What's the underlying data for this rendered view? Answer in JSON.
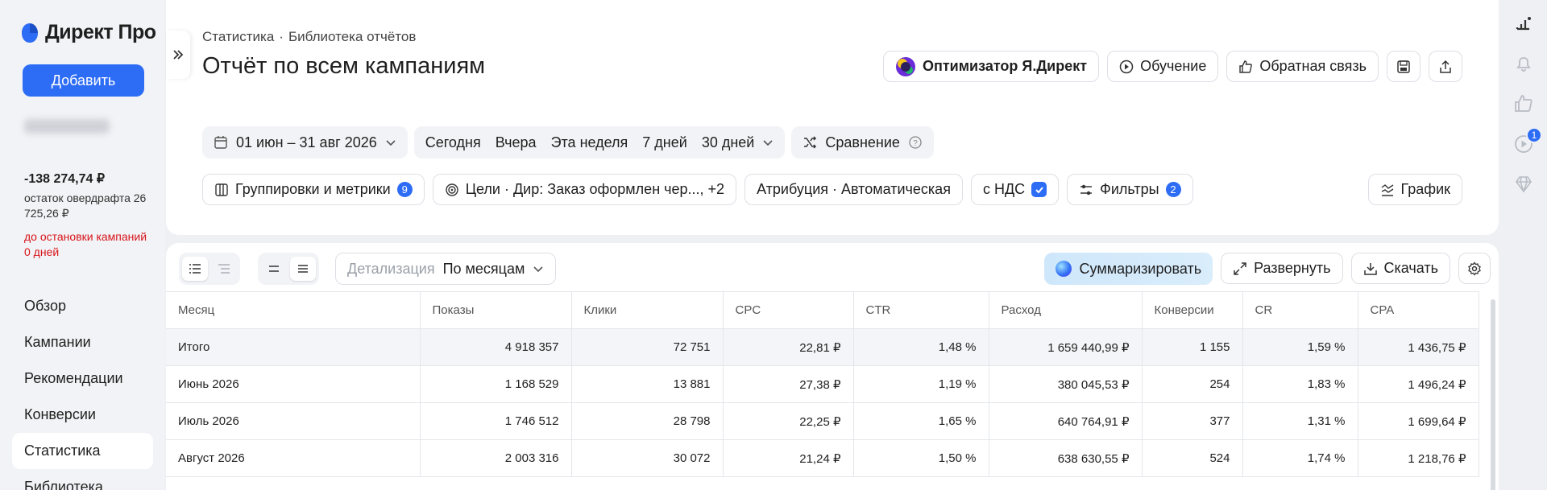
{
  "sidebar": {
    "logo_text": "Директ Про",
    "add_label": "Добавить",
    "balance": "-138 274,74 ₽",
    "overdraft_text": "остаток овердрафта 26 725,26 ₽",
    "warning_text": "до остановки кампаний 0 дней",
    "nav": [
      "Обзор",
      "Кампании",
      "Рекомендации",
      "Конверсии",
      "Статистика",
      "Библиотека"
    ],
    "active_item": "Статистика"
  },
  "header": {
    "breadcrumb": [
      "Статистика",
      "Библиотека отчётов"
    ],
    "breadcrumb_sep": "·",
    "title": "Отчёт по всем кампаниям",
    "optimizer_label": "Оптимизатор Я.Директ",
    "learning_label": "Обучение",
    "feedback_label": "Обратная связь"
  },
  "filters": {
    "date_range": "01 июн – 31 авг 2026",
    "periods": [
      "Сегодня",
      "Вчера",
      "Эта неделя",
      "7 дней",
      "30 дней"
    ],
    "compare_label": "Сравнение",
    "groupings_label": "Группировки и метрики",
    "groupings_count": "9",
    "goals_label": "Цели · Дир: Заказ оформлен чер..., +2",
    "attribution_label": "Атрибуция · Автоматическая",
    "vat_label": "с НДС",
    "filters_label": "Фильтры",
    "filters_count": "2",
    "chart_label": "График"
  },
  "toolbar": {
    "detail_label": "Детализация",
    "detail_value": "По месяцам",
    "summarize_label": "Суммаризировать",
    "expand_label": "Развернуть",
    "download_label": "Скачать"
  },
  "table": {
    "headers": [
      "Месяц",
      "Показы",
      "Клики",
      "CPC",
      "CTR",
      "Расход",
      "Конверсии",
      "CR",
      "CPA"
    ],
    "total": [
      "Итого",
      "4 918 357",
      "72 751",
      "22,81 ₽",
      "1,48 %",
      "1 659 440,99 ₽",
      "1 155",
      "1,59 %",
      "1 436,75 ₽"
    ],
    "rows": [
      [
        "Июнь 2026",
        "1 168 529",
        "13 881",
        "27,38 ₽",
        "1,19 %",
        "380 045,53 ₽",
        "254",
        "1,83 %",
        "1 496,24 ₽"
      ],
      [
        "Июль 2026",
        "1 746 512",
        "28 798",
        "22,25 ₽",
        "1,65 %",
        "640 764,91 ₽",
        "377",
        "1,31 %",
        "1 699,64 ₽"
      ],
      [
        "Август 2026",
        "2 003 316",
        "30 072",
        "21,24 ₽",
        "1,50 %",
        "638 630,55 ₽",
        "524",
        "1,74 %",
        "1 218,76 ₽"
      ]
    ]
  },
  "rail": {
    "notification_count": "1"
  },
  "colors": {
    "accent": "#2d6cf5",
    "warning": "#d7141a"
  }
}
